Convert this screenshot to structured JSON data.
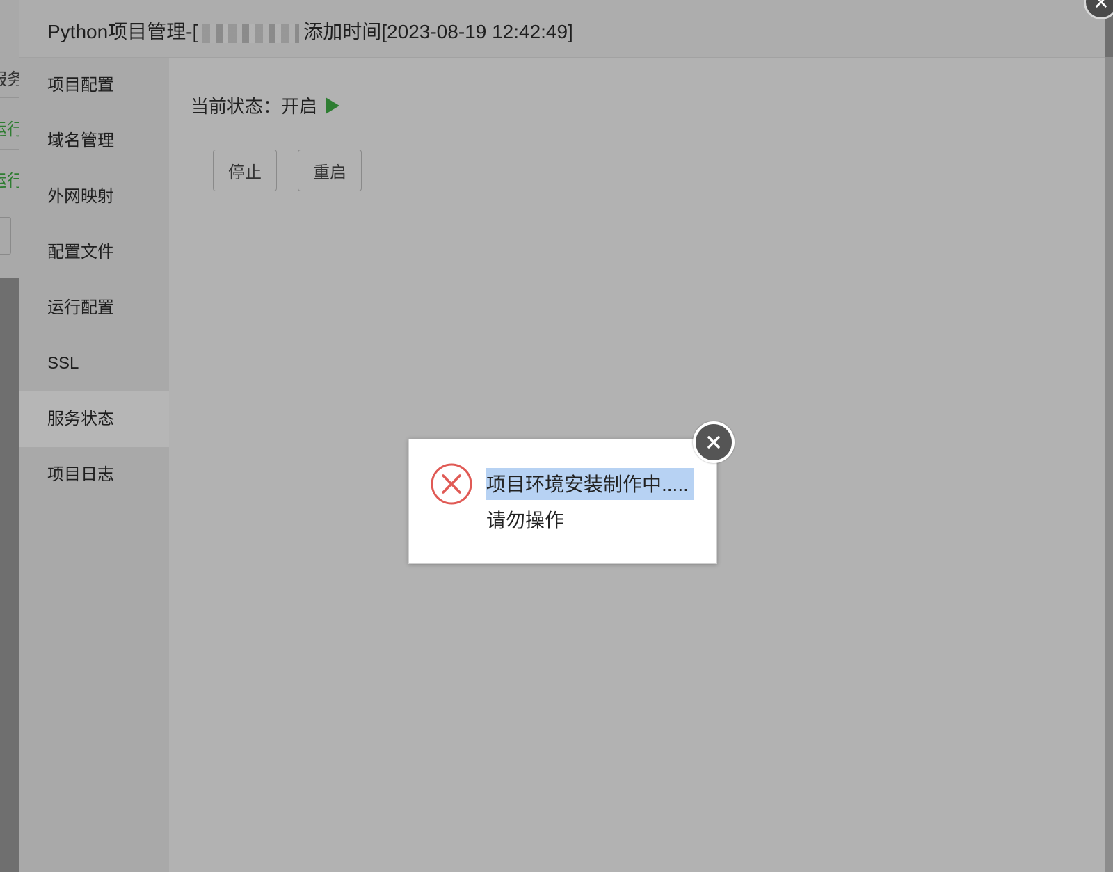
{
  "background": {
    "items": [
      "服务",
      "运行",
      "运行"
    ]
  },
  "dialog": {
    "title_prefix": "Python项目管理-[",
    "title_suffix": "添加时间[2023-08-19 12:42:49]",
    "sidebar": {
      "items": [
        {
          "label": "项目配置"
        },
        {
          "label": "域名管理"
        },
        {
          "label": "外网映射"
        },
        {
          "label": "配置文件"
        },
        {
          "label": "运行配置"
        },
        {
          "label": "SSL"
        },
        {
          "label": "服务状态"
        },
        {
          "label": "项目日志"
        }
      ],
      "active_index": 6
    },
    "content": {
      "status_label": "当前状态：",
      "status_value": "开启",
      "status_color": "#2e7d32",
      "stop_label": "停止",
      "restart_label": "重启"
    }
  },
  "popup": {
    "line1": "项目环境安装制作中.....",
    "line2": "请勿操作",
    "icon": "error-x-icon",
    "icon_color": "#e05a55",
    "highlight_color": "#b7d2f3"
  }
}
